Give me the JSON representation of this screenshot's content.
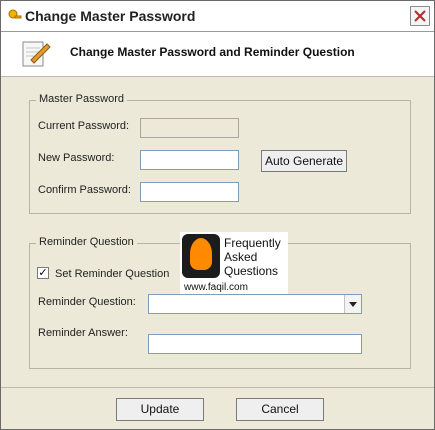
{
  "window": {
    "title": "Change Master Password",
    "header": "Change Master Password and Reminder Question"
  },
  "master_password": {
    "group_label": "Master Password",
    "current_label": "Current Password:",
    "new_label": "New Password:",
    "confirm_label": "Confirm Password:",
    "auto_generate": "Auto Generate"
  },
  "reminder": {
    "group_label": "Reminder Question",
    "set_reminder_label": "Set Reminder Question",
    "question_label": "Reminder Question:",
    "answer_label": "Reminder Answer:",
    "set_reminder_checked": true
  },
  "watermark": {
    "line1": "Frequently",
    "line2": "Asked",
    "line3": "Questions",
    "url": "www.faqil.com"
  },
  "footer": {
    "update": "Update",
    "cancel": "Cancel"
  }
}
